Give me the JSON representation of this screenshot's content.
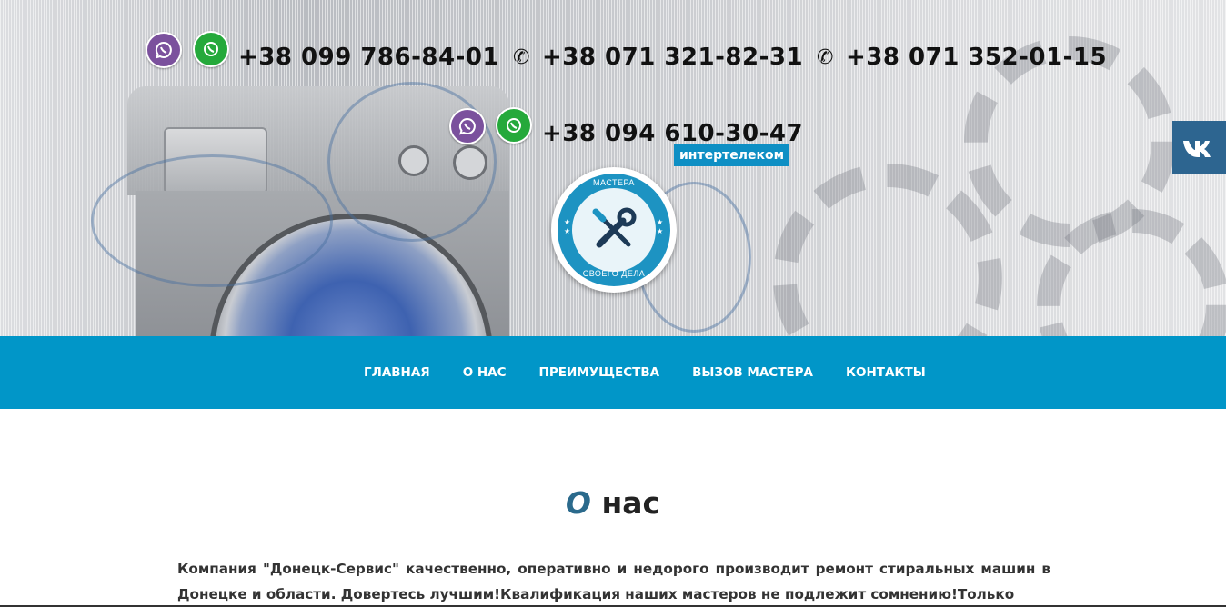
{
  "phones": {
    "p1": "+38 099 786-84-01",
    "p2": "+38 071 321-82-31",
    "p3": "+38 071 352-01-15",
    "p4": "+38 094 610-30-47",
    "p4_operator": "интертелеком"
  },
  "badge": {
    "top": "МАСТЕРА",
    "bottom": "СВОЕГО ДЕЛА"
  },
  "social": {
    "vk_label": "VK"
  },
  "nav": {
    "items": [
      {
        "label": "ГЛАВНАЯ"
      },
      {
        "label": "О НАС"
      },
      {
        "label": "ПРЕИМУЩЕСТВА"
      },
      {
        "label": "ВЫЗОВ МАСТЕРА"
      },
      {
        "label": "КОНТАКТЫ"
      }
    ]
  },
  "about": {
    "title_accent": "О",
    "title_rest": " нас",
    "text": "Компания \"Донецк-Сервис\" качественно, оперативно и недорого производит ремонт стиральных машин в Донецке и области. Довертесь лучшим!Квалификация наших мастеров не подлежит сомнению!Только"
  },
  "colors": {
    "nav_bg": "#0196c8",
    "vk_bg": "#2d6590",
    "accent_title": "#2b6a8c",
    "viber": "#7b519d",
    "whatsapp": "#25a93b"
  },
  "icons": [
    "viber-icon",
    "whatsapp-icon",
    "phone-icon",
    "vk-icon",
    "tools-icon"
  ]
}
